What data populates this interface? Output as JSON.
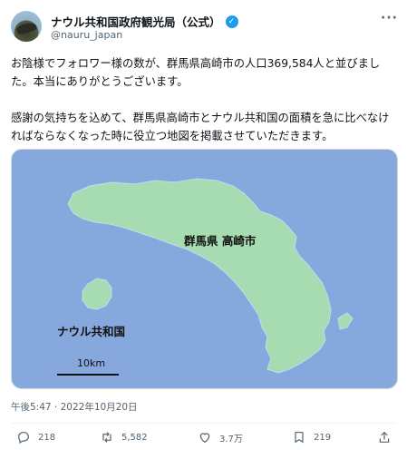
{
  "post": {
    "display_name": "ナウル共和国政府観光局（公式）",
    "verified_icon": "verified-badge-icon",
    "handle": "@nauru_japan",
    "more_icon": "more-icon",
    "text": "お陰様でフォロワー様の数が、群馬県高崎市の人口369,584人と並びました。本当にありがとうございます。\n\n感謝の気持ちを込めて、群馬県高崎市とナウル共和国の面積を急に比べなければならなくなった時に役立つ地図を掲載させていただきます。",
    "timestamp": "午後5:47 · 2022年10月20日"
  },
  "map": {
    "label_takasaki": "群馬県 高崎市",
    "label_nauru": "ナウル共和国",
    "scale_label": "10km",
    "colors": {
      "water": "#86a8dd",
      "land": "#a7dbb1",
      "coast": "#b9dff0"
    }
  },
  "actions": {
    "reply": {
      "icon": "reply-icon",
      "count": "218"
    },
    "retweet": {
      "icon": "retweet-icon",
      "count": "5,582"
    },
    "like": {
      "icon": "heart-icon",
      "count": "3.7万"
    },
    "bookmark": {
      "icon": "bookmark-icon",
      "count": "219"
    },
    "share": {
      "icon": "share-icon"
    }
  }
}
